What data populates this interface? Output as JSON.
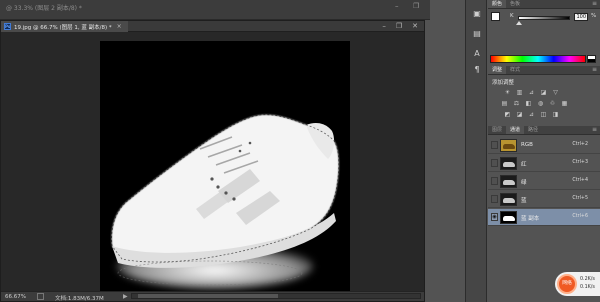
{
  "background_doc": {
    "title": "@ 33.3% (图层 2 副本/8) *"
  },
  "document": {
    "tab_title": "19.jpg @ 66.7% (图层 1, 蓝 副本/8) *",
    "ps_badge": "Ps",
    "close": "×",
    "controls": {
      "minimize": "–",
      "restore": "❐",
      "close": "✕"
    }
  },
  "status": {
    "zoom": "66.67%",
    "doc_size": "文档:1.83M/6.37M",
    "arrow": "▶"
  },
  "color_panel": {
    "tabs": [
      "颜色",
      "色板"
    ],
    "active_tab": 0,
    "channel_label": "K",
    "value": "100",
    "unit": "%"
  },
  "adjustments_panel": {
    "tabs": [
      "调整",
      "样式"
    ],
    "active_tab": 0,
    "title": "添加调整",
    "row1": [
      "☀",
      "▥",
      "⊿",
      "◪",
      "▽"
    ],
    "row2": [
      "▤",
      "⚖",
      "◧",
      "◍",
      "♲",
      "▦"
    ],
    "row3": [
      "◩",
      "◪",
      "⊿",
      "◫",
      "◨"
    ]
  },
  "channels_panel": {
    "tabs": [
      "图层",
      "通道",
      "路径"
    ],
    "active_tab": 1,
    "channels": [
      {
        "name": "RGB",
        "shortcut": "Ctrl+2",
        "thumb": "rgb",
        "visible": false,
        "selected": false
      },
      {
        "name": "红",
        "shortcut": "Ctrl+3",
        "thumb": "gray",
        "visible": false,
        "selected": false
      },
      {
        "name": "绿",
        "shortcut": "Ctrl+4",
        "thumb": "gray",
        "visible": false,
        "selected": false
      },
      {
        "name": "蓝",
        "shortcut": "Ctrl+5",
        "thumb": "gray",
        "visible": false,
        "selected": false
      },
      {
        "name": "蓝 副本",
        "shortcut": "Ctrl+6",
        "thumb": "mask",
        "visible": true,
        "selected": true
      }
    ]
  },
  "network_widget": {
    "label": "网络",
    "up": "0.2K/s",
    "down": "0.1K/s"
  },
  "dock_icons": [
    "▣",
    "▤",
    "A",
    "¶"
  ],
  "colors": {
    "accent_selected": "#7d8fa8",
    "widget_orange": "#f05a24"
  }
}
